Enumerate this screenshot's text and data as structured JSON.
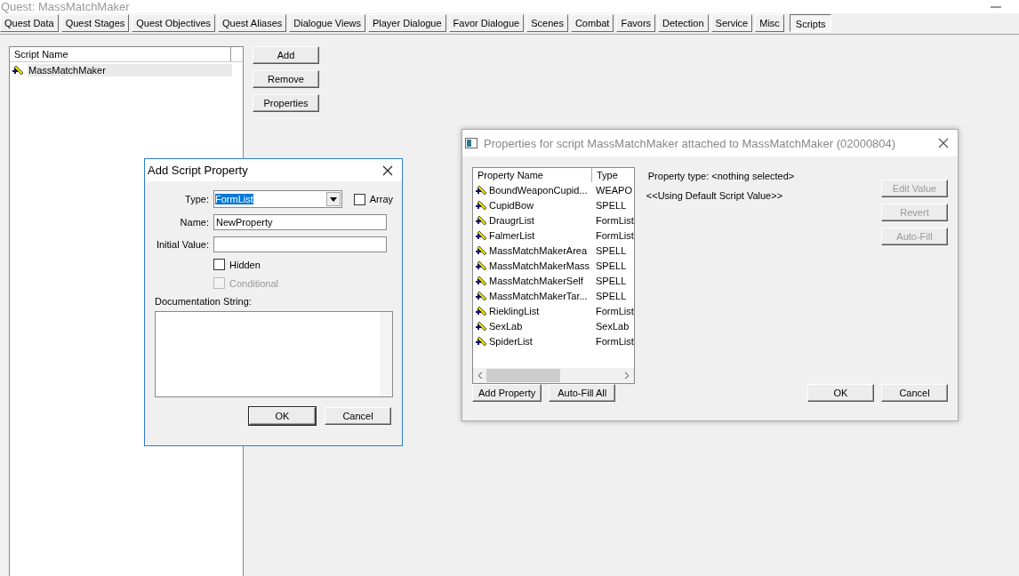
{
  "window": {
    "title": "Quest: MassMatchMaker"
  },
  "tabs": [
    {
      "label": "Quest Data",
      "selected": false
    },
    {
      "label": "Quest Stages",
      "selected": false
    },
    {
      "label": "Quest Objectives",
      "selected": false
    },
    {
      "label": "Quest Aliases",
      "selected": false
    },
    {
      "label": "Dialogue Views",
      "selected": false
    },
    {
      "label": "Player Dialogue",
      "selected": false
    },
    {
      "label": "Favor Dialogue",
      "selected": false
    },
    {
      "label": "Scenes",
      "selected": false
    },
    {
      "label": "Combat",
      "selected": false
    },
    {
      "label": "Favors",
      "selected": false
    },
    {
      "label": "Detection",
      "selected": false
    },
    {
      "label": "Service",
      "selected": false
    },
    {
      "label": "Misc",
      "selected": false
    },
    {
      "label": "Scripts",
      "selected": true
    }
  ],
  "scripts": {
    "columns": [
      "Script Name"
    ],
    "rows": [
      {
        "name": "MassMatchMaker",
        "selected": true
      }
    ]
  },
  "script_buttons": [
    "Add",
    "Remove",
    "Properties"
  ],
  "add_property_dialog": {
    "title": "Add Script Property",
    "type_label": "Type:",
    "type_value": "FormList",
    "array": {
      "label": "Array",
      "checked": false
    },
    "name_label": "Name:",
    "name_value": "NewProperty",
    "initial_label": "Initial Value:",
    "hidden": {
      "label": "Hidden",
      "checked": false,
      "disabled": false
    },
    "conditional": {
      "label": "Conditional",
      "checked": false,
      "disabled": true
    },
    "doc_label": "Documentation String:",
    "buttons": [
      "OK",
      "Cancel"
    ]
  },
  "properties_dialog": {
    "title": "Properties for script MassMatchMaker attached to MassMatchMaker (02000804)",
    "columns": [
      "Property Name",
      "Type"
    ],
    "rows": [
      {
        "name": "BoundWeaponCupid...",
        "type": "WEAPO"
      },
      {
        "name": "CupidBow",
        "type": "SPELL"
      },
      {
        "name": "DraugrList",
        "type": "FormList"
      },
      {
        "name": "FalmerList",
        "type": "FormList"
      },
      {
        "name": "MassMatchMakerArea",
        "type": "SPELL"
      },
      {
        "name": "MassMatchMakerMass",
        "type": "SPELL"
      },
      {
        "name": "MassMatchMakerSelf",
        "type": "SPELL"
      },
      {
        "name": "MassMatchMakerTar...",
        "type": "SPELL"
      },
      {
        "name": "RieklingList",
        "type": "FormList"
      },
      {
        "name": "SexLab",
        "type": "SexLab"
      },
      {
        "name": "SpiderList",
        "type": "FormList"
      }
    ],
    "property_type": "Property type: <nothing selected>",
    "default_value": "<<Using Default Script Value>>",
    "side_buttons": [
      {
        "label": "Edit Value",
        "disabled": true
      },
      {
        "label": "Revert",
        "disabled": true
      },
      {
        "label": "Auto-Fill",
        "disabled": true
      }
    ],
    "bottom_left_buttons": [
      "Add Property",
      "Auto-Fill All"
    ],
    "bottom_right_buttons": [
      "OK",
      "Cancel"
    ]
  }
}
